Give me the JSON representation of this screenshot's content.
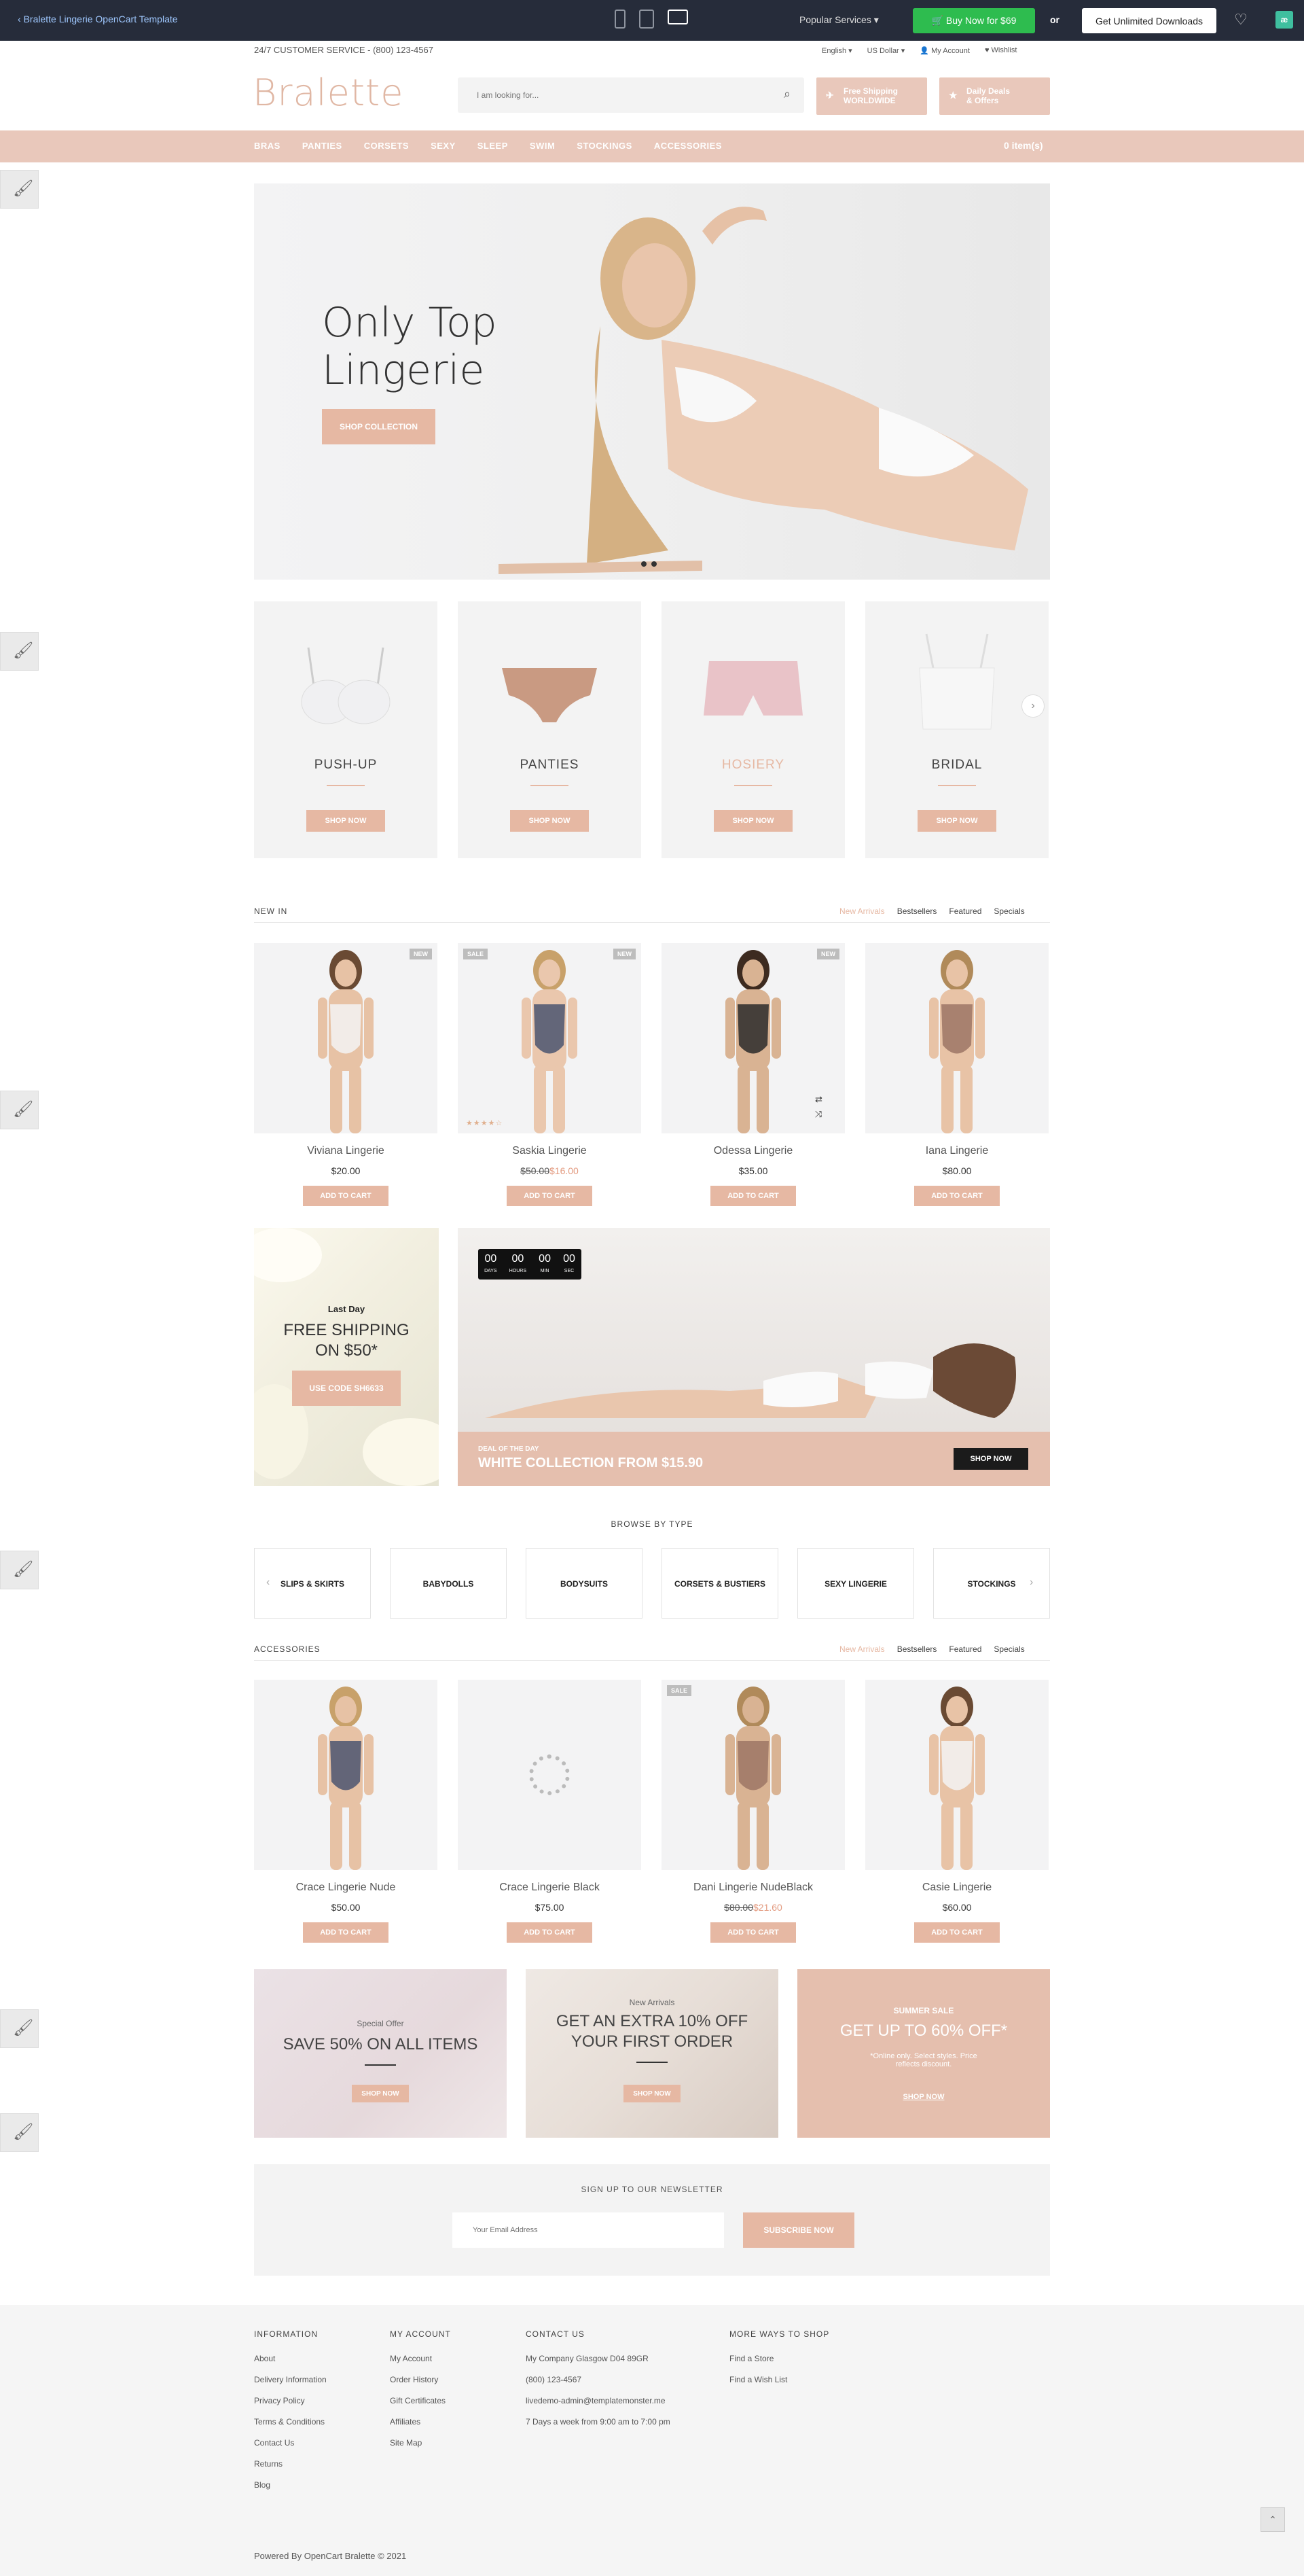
{
  "topbar": {
    "back_label": "Bralette Lingerie OpenCart Template",
    "popular": "Popular Services",
    "buy_label": "Buy Now for $69",
    "or": "or",
    "download_label": "Get Unlimited Downloads"
  },
  "header": {
    "service_phone": "24/7 CUSTOMER SERVICE - (800) 123-4567",
    "language": "English",
    "currency": "US Dollar",
    "account": "My Account",
    "wishlist": "Wishlist",
    "logo": "Bralette",
    "search_placeholder": "I am looking for...",
    "promo1_line1": "Free Shipping",
    "promo1_line2": "WORLDWIDE",
    "promo2_line1": "Daily Deals",
    "promo2_line2": "& Offers"
  },
  "nav": {
    "items": [
      "BRAS",
      "PANTIES",
      "CORSETS",
      "SEXY",
      "SLEEP",
      "SWIM",
      "STOCKINGS",
      "ACCESSORIES"
    ],
    "cart": "0 item(s)"
  },
  "hero": {
    "line1": "Only Top",
    "line2": "Lingerie",
    "button": "SHOP COLLECTION"
  },
  "categories": [
    {
      "name": "PUSH-UP",
      "button": "SHOP NOW"
    },
    {
      "name": "PANTIES",
      "button": "SHOP NOW"
    },
    {
      "name": "HOSIERY",
      "button": "SHOP NOW"
    },
    {
      "name": "BRIDAL",
      "button": "SHOP NOW"
    }
  ],
  "new_in": {
    "title": "NEW IN",
    "tabs": [
      "New Arrivals",
      "Bestsellers",
      "Featured",
      "Specials"
    ],
    "products": [
      {
        "name": "Viviana Lingerie",
        "price": "$20.00",
        "old": "",
        "badge_right": "NEW",
        "badge_left": "",
        "button": "ADD TO CART"
      },
      {
        "name": "Saskia Lingerie",
        "price": "$16.00",
        "old": "$50.00",
        "badge_right": "NEW",
        "badge_left": "SALE",
        "button": "ADD TO CART"
      },
      {
        "name": "Odessa Lingerie",
        "price": "$35.00",
        "old": "",
        "badge_right": "NEW",
        "badge_left": "",
        "button": "ADD TO CART"
      },
      {
        "name": "Iana Lingerie",
        "price": "$80.00",
        "old": "",
        "badge_right": "",
        "badge_left": "",
        "button": "ADD TO CART"
      }
    ]
  },
  "promo": {
    "last_day": "Last Day",
    "free_line1": "FREE SHIPPING",
    "free_line2": "ON $50*",
    "code_button": "USE CODE SH6633",
    "countdown": [
      {
        "value": "00",
        "unit": "DAYS"
      },
      {
        "value": "00",
        "unit": "HOURS"
      },
      {
        "value": "00",
        "unit": "MIN"
      },
      {
        "value": "00",
        "unit": "SEC"
      }
    ],
    "deal_label": "DEAL OF THE DAY",
    "deal_title": "WHITE COLLECTION FROM $15.90",
    "deal_button": "SHOP NOW"
  },
  "browse": {
    "title": "BROWSE BY TYPE",
    "types": [
      "SLIPS & SKIRTS",
      "BABYDOLLS",
      "BODYSUITS",
      "CORSETS & BUSTIERS",
      "SEXY LINGERIE",
      "STOCKINGS"
    ]
  },
  "accessories": {
    "title": "ACCESSORIES",
    "tabs": [
      "New Arrivals",
      "Bestsellers",
      "Featured",
      "Specials"
    ],
    "products": [
      {
        "name": "Crace Lingerie Nude",
        "price": "$50.00",
        "old": "",
        "badge_left": "",
        "button": "ADD TO CART"
      },
      {
        "name": "Crace Lingerie Black",
        "price": "$75.00",
        "old": "",
        "badge_left": "",
        "button": "ADD TO CART"
      },
      {
        "name": "Dani Lingerie NudeBlack",
        "price": "$21.60",
        "old": "$80.00",
        "badge_left": "SALE",
        "button": "ADD TO CART"
      },
      {
        "name": "Casie Lingerie",
        "price": "$60.00",
        "old": "",
        "badge_left": "",
        "button": "ADD TO CART"
      }
    ]
  },
  "banners": {
    "b1_small": "Special Offer",
    "b1_big": "SAVE 50% ON ALL ITEMS",
    "b1_button": "SHOP NOW",
    "b2_small": "New Arrivals",
    "b2_line1": "GET AN EXTRA 10% OFF",
    "b2_line2": "YOUR FIRST ORDER",
    "b2_button": "SHOP NOW",
    "b3_small": "SUMMER SALE",
    "b3_big": "GET UP TO 60% OFF*",
    "b3_note1": "*Online only. Select styles. Price",
    "b3_note2": "reflects discount.",
    "b3_button": "SHOP NOW"
  },
  "newsletter": {
    "title": "SIGN UP TO OUR NEWSLETTER",
    "placeholder": "Your Email Address",
    "button": "SUBSCRIBE NOW"
  },
  "footer": {
    "info_title": "INFORMATION",
    "info_links": [
      "About",
      "Delivery Information",
      "Privacy Policy",
      "Terms & Conditions",
      "Contact Us",
      "Returns",
      "Blog"
    ],
    "account_title": "MY ACCOUNT",
    "account_links": [
      "My Account",
      "Order History",
      "Gift Certificates",
      "Affiliates",
      "Site Map"
    ],
    "contact_title": "CONTACT US",
    "contact_lines": [
      "My Company Glasgow D04 89GR",
      "(800) 123-4567",
      "livedemo-admin@templatemonster.me",
      "7 Days a week from 9:00 am to 7:00 pm"
    ],
    "more_title": "MORE WAYS TO SHOP",
    "more_links": [
      "Find a Store",
      "Find a Wish List"
    ],
    "copyright": "Powered By OpenCart Bralette © 2021"
  }
}
